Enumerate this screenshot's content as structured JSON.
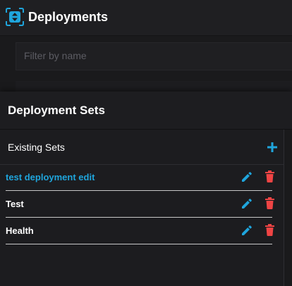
{
  "app": {
    "title": "Deployments",
    "logo_icon": "deployments-logo-icon",
    "accent_color": "#1fa5dc"
  },
  "filter": {
    "placeholder": "Filter by name",
    "value": ""
  },
  "panel": {
    "title": "Deployment Sets",
    "existing_sets_label": "Existing Sets",
    "add_icon": "plus-icon",
    "sets": [
      {
        "label": "test deployment edit",
        "selected": true,
        "edit_icon": "pencil-icon",
        "delete_icon": "trash-icon"
      },
      {
        "label": "Test",
        "selected": false,
        "edit_icon": "pencil-icon",
        "delete_icon": "trash-icon"
      },
      {
        "label": "Health",
        "selected": false,
        "edit_icon": "pencil-icon",
        "delete_icon": "trash-icon"
      }
    ]
  },
  "colors": {
    "edit_icon": "#1fa5dc",
    "delete_icon": "#ef4444",
    "selected_text": "#1fa5dc"
  }
}
